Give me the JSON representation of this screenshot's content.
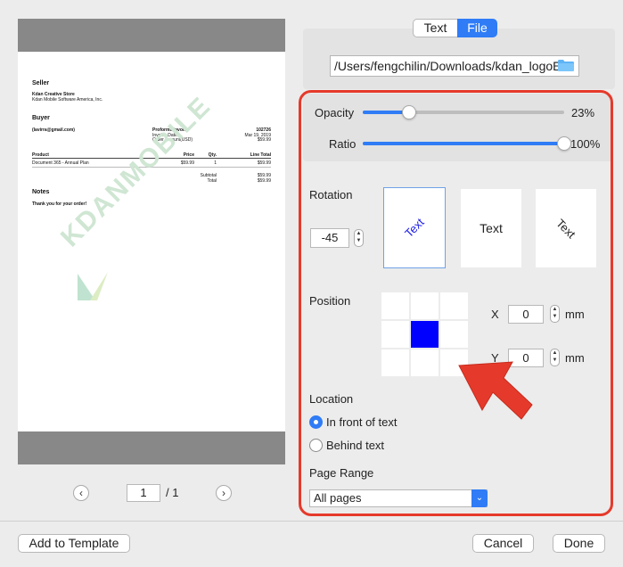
{
  "preview": {
    "seller_heading": "Seller",
    "seller_name": "Kdan Creative Store",
    "seller_company": "Kdan Mobile Software America, Inc.",
    "buyer_heading": "Buyer",
    "buyer_email": "(lavirra@gmail.com)",
    "proforma_label": "Proforma Invoice",
    "invoice_date_label": "Invoice Date",
    "order_amount_label": "Order Amount(USD)",
    "invoice_number": "102726",
    "invoice_date": "Mar 19, 2019",
    "order_amount": "$59.99",
    "col_product": "Product",
    "col_price": "Price",
    "col_qty": "Qty.",
    "col_line_total": "Line Total",
    "item_name": "Document 365 - Annual Plan",
    "item_price": "$59.99",
    "item_qty": "1",
    "item_total": "$59.99",
    "subtotal_label": "Subtotal",
    "subtotal_value": "$59.99",
    "total_label": "Total",
    "total_value": "$59.99",
    "notes_heading": "Notes",
    "notes_text": "Thank you for your order!",
    "watermark_text": "KDANMOBILE"
  },
  "pager": {
    "current_page": "1",
    "total": "/ 1"
  },
  "tabs": {
    "text": "Text",
    "file": "File",
    "active": "File"
  },
  "file": {
    "path": "/Users/fengchilin/Downloads/kdan_logoE"
  },
  "opacity": {
    "label": "Opacity",
    "value": 23,
    "display": "23%"
  },
  "ratio": {
    "label": "Ratio",
    "value": 100,
    "display": "100%"
  },
  "rotation": {
    "label": "Rotation",
    "value": "-45",
    "options": [
      {
        "label": "Text",
        "angle": -45,
        "selected": true
      },
      {
        "label": "Text",
        "angle": 0,
        "selected": false
      },
      {
        "label": "Text",
        "angle": 45,
        "selected": false
      }
    ]
  },
  "position": {
    "label": "Position",
    "selected_cell": 4,
    "x_label": "X",
    "x_value": "0",
    "x_unit": "mm",
    "y_label": "Y",
    "y_value": "0",
    "y_unit": "mm"
  },
  "location": {
    "label": "Location",
    "front_label": "In front of text",
    "behind_label": "Behind text",
    "selected": "front"
  },
  "page_range": {
    "label": "Page Range",
    "value": "All pages"
  },
  "buttons": {
    "add_template": "Add to Template",
    "cancel": "Cancel",
    "done": "Done"
  },
  "colors": {
    "accent": "#2f7cf6",
    "highlight": "#e53a2b",
    "position_selected": "#0000ff"
  },
  "icons": {
    "folder": "folder-icon",
    "prev": "chevron-left-icon",
    "next": "chevron-right-icon",
    "dropdown": "chevron-down-icon"
  }
}
